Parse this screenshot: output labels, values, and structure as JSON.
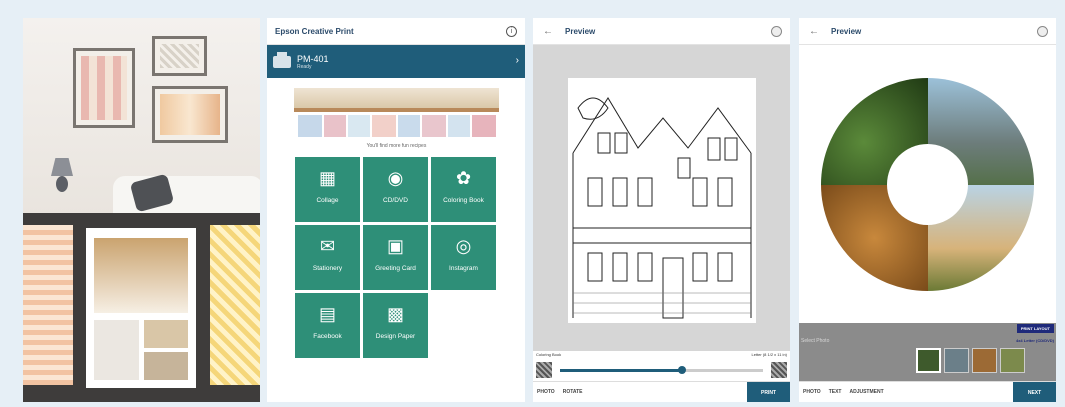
{
  "app": {
    "title": "Epson Creative Print",
    "printer": {
      "name": "PM-401",
      "status": "Ready"
    },
    "banner_text": "You'll find more fun recipes",
    "menu_items": [
      {
        "label": "Collage",
        "icon": "collage-icon"
      },
      {
        "label": "CD/DVD",
        "icon": "disc-icon"
      },
      {
        "label": "Coloring Book",
        "icon": "butterfly-icon"
      },
      {
        "label": "Stationery",
        "icon": "envelope-icon"
      },
      {
        "label": "Greeting Card",
        "icon": "greeting-card-icon"
      },
      {
        "label": "Instagram",
        "icon": "instagram-icon"
      },
      {
        "label": "Facebook",
        "icon": "facebook-icon"
      },
      {
        "label": "Design Paper",
        "icon": "design-paper-icon"
      }
    ]
  },
  "preview_coloring": {
    "title": "Preview",
    "paper_type": "Coloring Book",
    "paper_size": "Letter (8 1/2 x 11 in)",
    "slider_level": 0.6,
    "options": [
      "PHOTO",
      "ROTATE"
    ],
    "action": "PRINT"
  },
  "preview_cd": {
    "title": "Preview",
    "print_layout_label": "PRINT LAYOUT",
    "select_photo_label": "Select Photo",
    "size_label": "4x4 Letter (CD/DVD)",
    "options": [
      "PHOTO",
      "TEXT",
      "ADJUSTMENT"
    ],
    "action": "NEXT"
  },
  "colors": {
    "accent": "#1f5d7a",
    "tile": "#2e8f78",
    "background": "#e6eff6"
  }
}
